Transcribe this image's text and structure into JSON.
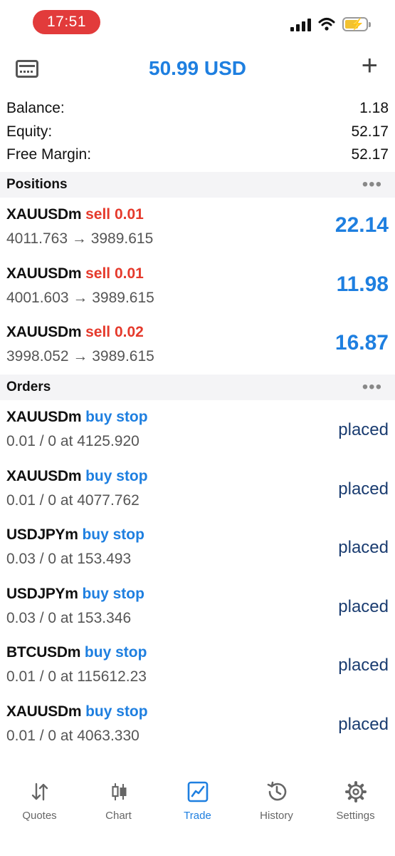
{
  "status_bar": {
    "time": "17:51"
  },
  "header": {
    "title": "50.99 USD"
  },
  "summary": [
    {
      "label": "Balance:",
      "value": "1.18"
    },
    {
      "label": "Equity:",
      "value": "52.17"
    },
    {
      "label": "Free Margin:",
      "value": "52.17"
    }
  ],
  "positions": {
    "header": "Positions",
    "items": [
      {
        "symbol": "XAUUSDm",
        "side": "sell 0.01",
        "prices": "4011.763 → 3989.615",
        "profit": "22.14"
      },
      {
        "symbol": "XAUUSDm",
        "side": "sell 0.01",
        "prices": "4001.603 → 3989.615",
        "profit": "11.98"
      },
      {
        "symbol": "XAUUSDm",
        "side": "sell 0.02",
        "prices": "3998.052 → 3989.615",
        "profit": "16.87"
      }
    ]
  },
  "orders": {
    "header": "Orders",
    "items": [
      {
        "symbol": "XAUUSDm",
        "side": "buy stop",
        "details": "0.01 / 0 at 4125.920",
        "state": "placed"
      },
      {
        "symbol": "XAUUSDm",
        "side": "buy stop",
        "details": "0.01 / 0 at 4077.762",
        "state": "placed"
      },
      {
        "symbol": "USDJPYm",
        "side": "buy stop",
        "details": "0.03 / 0 at 153.493",
        "state": "placed"
      },
      {
        "symbol": "USDJPYm",
        "side": "buy stop",
        "details": "0.03 / 0 at 153.346",
        "state": "placed"
      },
      {
        "symbol": "BTCUSDm",
        "side": "buy stop",
        "details": "0.01 / 0 at 115612.23",
        "state": "placed"
      },
      {
        "symbol": "XAUUSDm",
        "side": "buy stop",
        "details": "0.01 / 0 at 4063.330",
        "state": "placed"
      }
    ]
  },
  "tabs": [
    {
      "label": "Quotes",
      "icon": "quotes-icon"
    },
    {
      "label": "Chart",
      "icon": "chart-icon"
    },
    {
      "label": "Trade",
      "icon": "trade-icon",
      "active": true
    },
    {
      "label": "History",
      "icon": "history-icon"
    },
    {
      "label": "Settings",
      "icon": "settings-icon"
    }
  ],
  "colors": {
    "accent": "#1e7fe0",
    "sell": "#e53a2c",
    "time_pill": "#e23b3b",
    "battery": "#f2c230"
  }
}
